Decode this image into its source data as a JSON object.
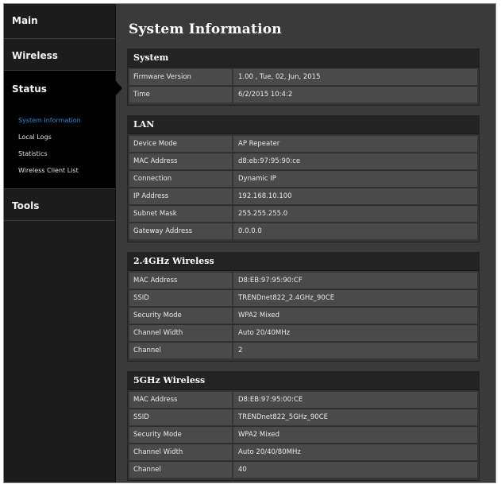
{
  "sidebar": {
    "items": [
      {
        "label": "Main"
      },
      {
        "label": "Wireless"
      },
      {
        "label": "Status"
      },
      {
        "label": "Tools"
      }
    ],
    "status_subitems": [
      {
        "label": "System Information"
      },
      {
        "label": "Local Logs"
      },
      {
        "label": "Statistics"
      },
      {
        "label": "Wireless Client List"
      }
    ],
    "active_color": "#2a86d9"
  },
  "page": {
    "title": "System Information"
  },
  "sections": {
    "system": {
      "header": "System",
      "rows": [
        {
          "label": "Firmware Version",
          "value": "1.00 , Tue, 02, Jun, 2015"
        },
        {
          "label": "Time",
          "value": "6/2/2015 10:4:2"
        }
      ]
    },
    "lan": {
      "header": "LAN",
      "rows": [
        {
          "label": "Device Mode",
          "value": "AP Repeater"
        },
        {
          "label": "MAC Address",
          "value": "d8:eb:97:95:90:ce"
        },
        {
          "label": "Connection",
          "value": "Dynamic IP"
        },
        {
          "label": "IP Address",
          "value": "192.168.10.100"
        },
        {
          "label": "Subnet Mask",
          "value": "255.255.255.0"
        },
        {
          "label": "Gateway Address",
          "value": "0.0.0.0"
        }
      ]
    },
    "wireless24": {
      "header": "2.4GHz Wireless",
      "rows": [
        {
          "label": "MAC Address",
          "value": "D8:EB:97:95:90:CF"
        },
        {
          "label": "SSID",
          "value": "TRENDnet822_2.4GHz_90CE"
        },
        {
          "label": "Security Mode",
          "value": "WPA2 Mixed"
        },
        {
          "label": "Channel Width",
          "value": "Auto 20/40MHz"
        },
        {
          "label": "Channel",
          "value": "2"
        }
      ]
    },
    "wireless5": {
      "header": "5GHz Wireless",
      "rows": [
        {
          "label": "MAC Address",
          "value": "D8:EB:97:95:00:CE"
        },
        {
          "label": "SSID",
          "value": "TRENDnet822_5GHz_90CE"
        },
        {
          "label": "Security Mode",
          "value": "WPA2 Mixed"
        },
        {
          "label": "Channel Width",
          "value": "Auto 20/40/80MHz"
        },
        {
          "label": "Channel",
          "value": "40"
        }
      ]
    }
  }
}
